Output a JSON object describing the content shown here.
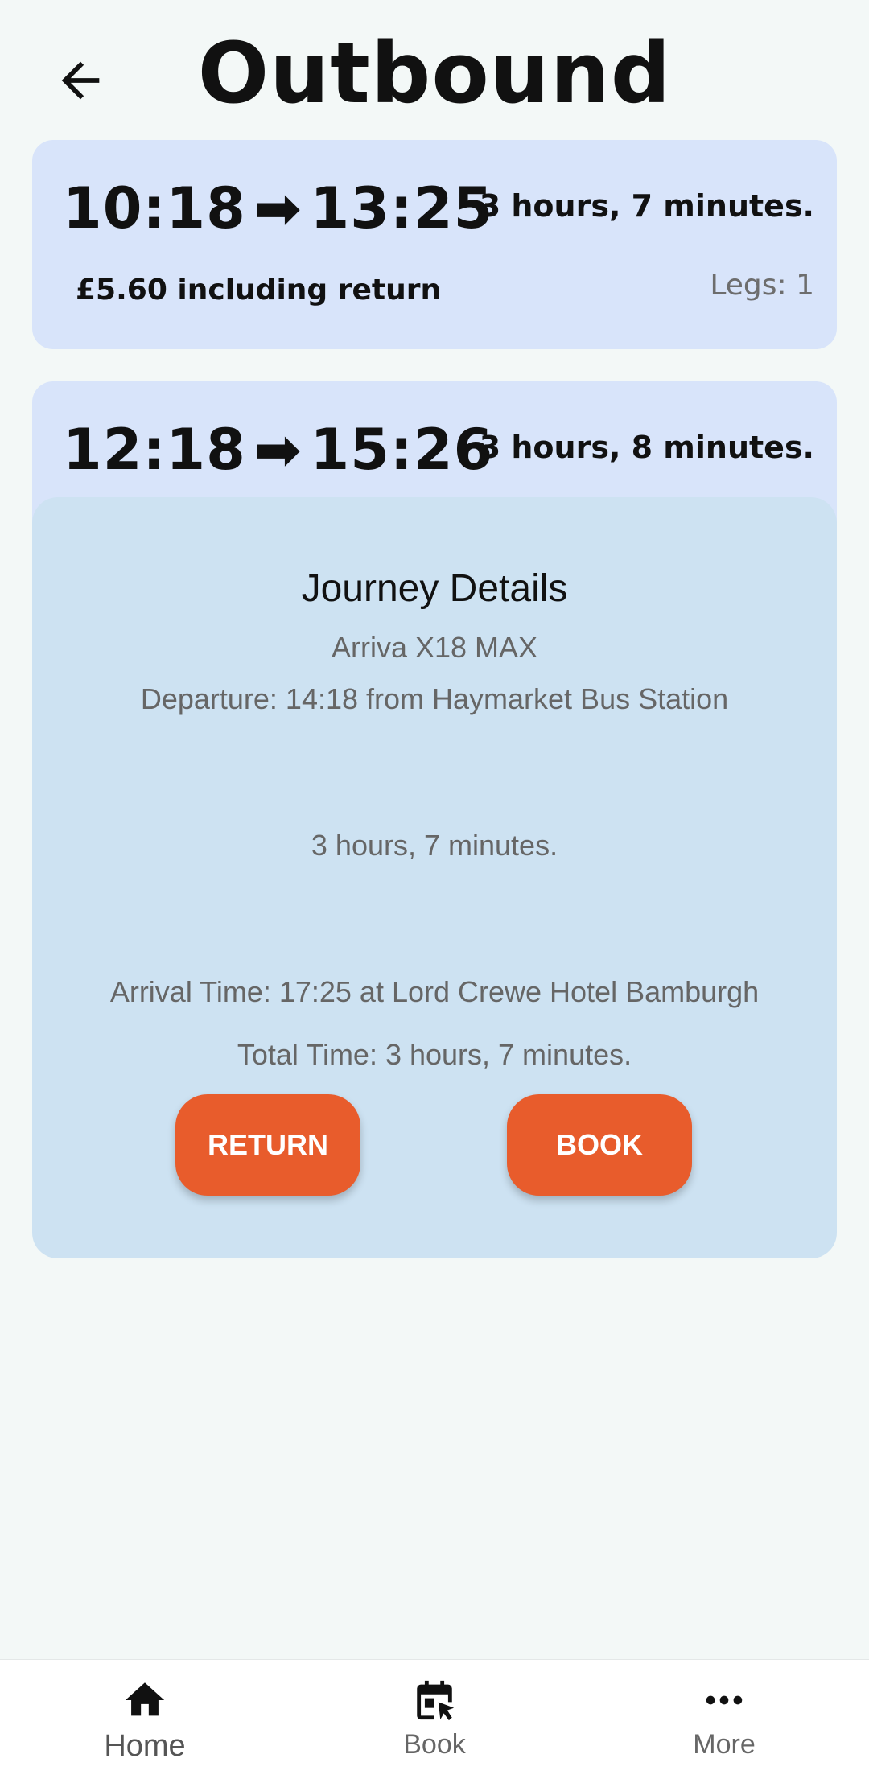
{
  "header": {
    "title": "Outbound",
    "back_icon": "arrow-back-icon"
  },
  "journeys": [
    {
      "depart": "10:18",
      "arrive": "13:25",
      "duration": "3 hours, 7 minutes.",
      "price": "£5.60 including return",
      "legs": "Legs: 1"
    },
    {
      "depart": "12:18",
      "arrive": "15:26",
      "duration": "3 hours, 8 minutes."
    }
  ],
  "arrow_glyph": "➡",
  "details": {
    "title": "Journey Details",
    "operator": "Arriva X18 MAX",
    "departure": "Departure: 14:18 from Haymarket Bus Station",
    "duration": "3 hours, 7 minutes.",
    "arrival": "Arrival Time: 17:25 at Lord Crewe Hotel Bamburgh",
    "total": "Total Time: 3 hours, 7 minutes.",
    "return_label": "RETURN",
    "book_label": "BOOK"
  },
  "nav": {
    "home": "Home",
    "book": "Book",
    "more": "More"
  },
  "colors": {
    "background": "#f3f8f7",
    "card": "#d8e4fa",
    "sheet": "#cde2f2",
    "accent": "#e85c2c"
  }
}
